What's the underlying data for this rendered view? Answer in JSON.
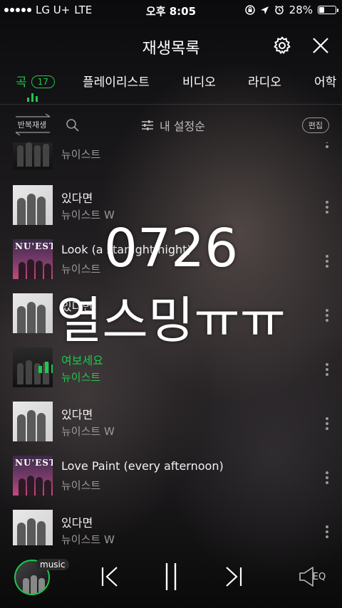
{
  "status_bar": {
    "carrier": "LG U+",
    "network": "LTE",
    "time": "오후 8:05",
    "battery": "28%",
    "battery_level": 0.28
  },
  "header": {
    "title": "재생목록",
    "settings_icon": "gear-icon",
    "close_icon": "close-icon"
  },
  "tabs": [
    {
      "label": "곡",
      "count": "17",
      "active": true
    },
    {
      "label": "플레이리스트"
    },
    {
      "label": "비디오"
    },
    {
      "label": "라디오"
    },
    {
      "label": "어학"
    }
  ],
  "toolbar": {
    "repeat_label": "반복재생",
    "sort_label": "내 설정순",
    "edit_label": "편집"
  },
  "songs": [
    {
      "title": "",
      "artist": "뉴이스트",
      "art": "dark"
    },
    {
      "title": "있다면",
      "artist": "뉴이스트 W",
      "art": "gray"
    },
    {
      "title": "Look (a starlight night)",
      "artist": "뉴이스트",
      "art": "nuest"
    },
    {
      "title": "있다면",
      "artist": "",
      "art": "gray"
    },
    {
      "title": "여보세요",
      "artist": "뉴이스트",
      "art": "dark",
      "playing": true
    },
    {
      "title": "있다면",
      "artist": "뉴이스트 W",
      "art": "gray"
    },
    {
      "title": "Love Paint (every afternoon)",
      "artist": "뉴이스트",
      "art": "nuest"
    },
    {
      "title": "있다면",
      "artist": "뉴이스트 W",
      "art": "gray"
    }
  ],
  "overlay": {
    "number": "0726",
    "text": "열스밍ㅠㅠ"
  },
  "player": {
    "badge": "music",
    "eq_label": "EQ"
  },
  "colors": {
    "accent": "#1ec84a"
  }
}
